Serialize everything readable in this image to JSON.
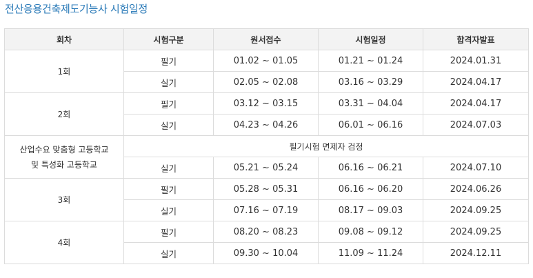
{
  "page_title": "전산응용건축제도기능사 시험일정",
  "headers": [
    "회차",
    "시험구분",
    "원서접수",
    "시험일정",
    "합격자발표"
  ],
  "rounds": [
    {
      "name": "1회",
      "rows": [
        {
          "type": "필기",
          "application": "01.02 ~ 01.05",
          "exam": "01.21 ~ 01.24",
          "result": "2024.01.31"
        },
        {
          "type": "실기",
          "application": "02.05 ~ 02.08",
          "exam": "03.16 ~ 03.29",
          "result": "2024.04.17"
        }
      ]
    },
    {
      "name": "2회",
      "rows": [
        {
          "type": "필기",
          "application": "03.12 ~ 03.15",
          "exam": "03.31 ~ 04.04",
          "result": "2024.04.17"
        },
        {
          "type": "실기",
          "application": "04.23 ~ 04.26",
          "exam": "06.01 ~ 06.16",
          "result": "2024.07.03"
        }
      ]
    },
    {
      "name_line1": "산업수요 맞춤형 고등학교",
      "name_line2": "및 특성화 고등학교",
      "note": "필기시험 면제자 검정",
      "rows": [
        {
          "type": "실기",
          "application": "05.21 ~ 05.24",
          "exam": "06.16 ~ 06.21",
          "result": "2024.07.10"
        }
      ]
    },
    {
      "name": "3회",
      "rows": [
        {
          "type": "필기",
          "application": "05.28 ~ 05.31",
          "exam": "06.16 ~ 06.20",
          "result": "2024.06.26"
        },
        {
          "type": "실기",
          "application": "07.16 ~ 07.19",
          "exam": "08.17 ~ 09.03",
          "result": "2024.09.25"
        }
      ]
    },
    {
      "name": "4회",
      "rows": [
        {
          "type": "필기",
          "application": "08.20 ~ 08.23",
          "exam": "09.08 ~ 09.12",
          "result": "2024.09.25"
        },
        {
          "type": "실기",
          "application": "09.30 ~ 10.04",
          "exam": "11.09 ~ 11.24",
          "result": "2024.12.11"
        }
      ]
    }
  ]
}
